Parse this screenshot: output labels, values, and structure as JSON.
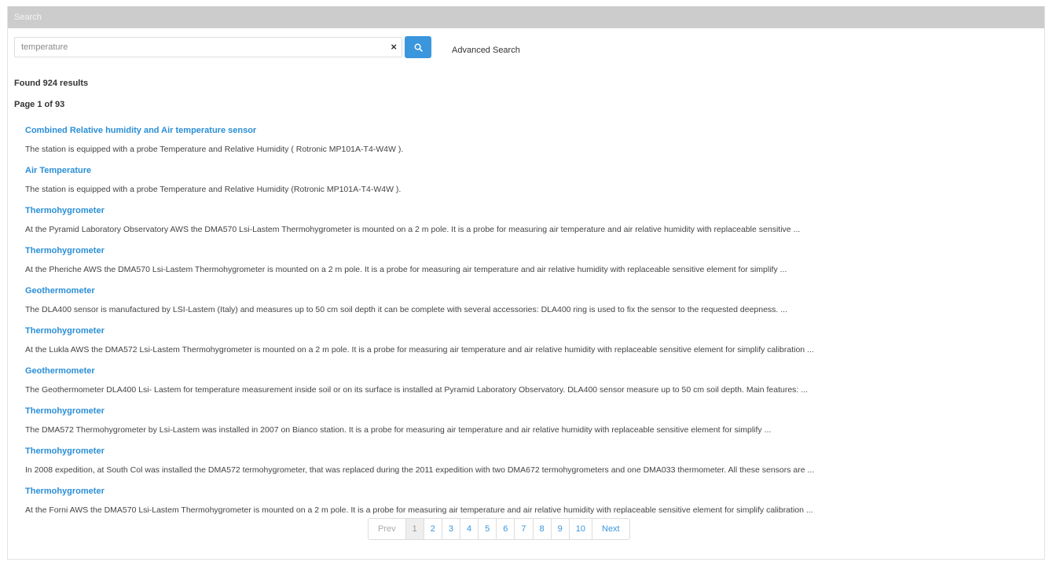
{
  "panel": {
    "title": "Search"
  },
  "search": {
    "value": "temperature",
    "placeholder": "",
    "clear_label": "×",
    "advanced_label": "Advanced Search"
  },
  "summary": {
    "found": "Found 924 results",
    "page": "Page 1 of 93"
  },
  "results": [
    {
      "title": "Combined Relative humidity and Air temperature sensor",
      "desc": "The station is equipped with a probe Temperature and Relative Humidity ( Rotronic MP101A-T4-W4W )."
    },
    {
      "title": "Air Temperature",
      "desc": "The station is equipped with a probe Temperature and Relative Humidity (Rotronic MP101A-T4-W4W )."
    },
    {
      "title": "Thermohygrometer",
      "desc": "At the Pyramid Laboratory Observatory AWS the DMA570 Lsi-Lastem Thermohygrometer is mounted on a 2 m pole. It is a probe for measuring air temperature and air relative humidity with replaceable sensitive ..."
    },
    {
      "title": "Thermohygrometer",
      "desc": "At the Pheriche AWS the DMA570 Lsi-Lastem Thermohygrometer is mounted on a 2 m pole. It is a probe for measuring air temperature and air relative humidity with replaceable sensitive element for simplify ..."
    },
    {
      "title": "Geothermometer",
      "desc": "The DLA400 sensor is manufactured by LSI-Lastem (Italy) and measures up to 50 cm soil depth it can be complete with several accessories: DLA400 ring is used to fix the sensor to the requested deepness. ..."
    },
    {
      "title": "Thermohygrometer",
      "desc": "At the Lukla AWS the DMA572 Lsi-Lastem Thermohygrometer is mounted on a 2 m pole. It is a probe for measuring air temperature and air relative humidity with replaceable sensitive element for simplify calibration ..."
    },
    {
      "title": "Geothermometer",
      "desc": "The Geothermometer DLA400 Lsi- Lastem for temperature measurement inside soil or on its surface is installed at Pyramid Laboratory Observatory. DLA400 sensor measure up to 50 cm soil depth. Main features: ..."
    },
    {
      "title": "Thermohygrometer",
      "desc": "The DMA572 Thermohygrometer by Lsi-Lastem was installed in 2007 on Bianco station. It is a probe for measuring air temperature and air relative humidity with replaceable sensitive element for simplify ..."
    },
    {
      "title": "Thermohygrometer",
      "desc": "In 2008 expedition, at South Col was installed the DMA572 termohygrometer, that was replaced during the 2011 expedition with two DMA672 termohygrometers and one DMA033 thermometer. All these sensors are ..."
    },
    {
      "title": "Thermohygrometer",
      "desc": "At the Forni AWS the DMA570 Lsi-Lastem Thermohygrometer is mounted on a 2 m pole. It is a probe for measuring air temperature and air relative humidity with replaceable sensitive element for simplify calibration ..."
    }
  ],
  "pagination": {
    "prev": "Prev",
    "pages": [
      "1",
      "2",
      "3",
      "4",
      "5",
      "6",
      "7",
      "8",
      "9",
      "10"
    ],
    "next": "Next",
    "current": "1"
  },
  "colors": {
    "accent": "#3a96dd",
    "link": "#2a8fd6",
    "heading_bar": "#cccccc"
  },
  "icons": {
    "search_button": "search-icon",
    "clear": "clear-icon"
  }
}
